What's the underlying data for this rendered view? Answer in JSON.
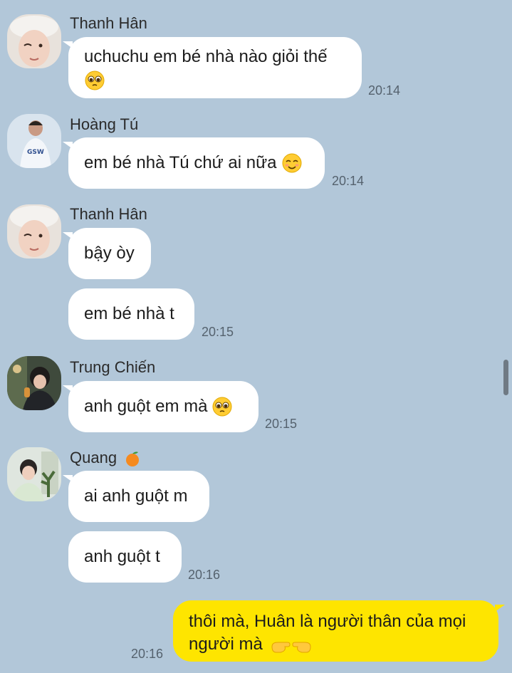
{
  "chat": {
    "colors": {
      "background": "#b2c7d9",
      "incoming_bubble": "#ffffff",
      "outgoing_bubble": "#fee500"
    },
    "messages": [
      {
        "sender": "Thanh Hân",
        "text": "uchuchu em bé nhà nào giỏi thế",
        "emoji": "pleading-face-emoji",
        "time": "20:14"
      },
      {
        "sender": "Hoàng Tú",
        "text": "em bé nhà Tú chứ ai nữa",
        "emoji": "smiling-face-emoji",
        "time": "20:14"
      },
      {
        "sender": "Thanh Hân",
        "text": "bậy òy"
      },
      {
        "text": "em bé nhà t",
        "time": "20:15"
      },
      {
        "sender": "Trung Chiến",
        "text": "anh guột em mà",
        "emoji": "pleading-face-emoji",
        "time": "20:15"
      },
      {
        "sender": "Quang",
        "sender_emoji": "tangerine-emoji",
        "text": "ai anh guột m"
      },
      {
        "text": "anh guột t",
        "time": "20:16"
      },
      {
        "outgoing": true,
        "text_line1": "thôi mà, Huân là người thân của mọi",
        "text_line2": "người mà",
        "emoji": "pointing-hands-emoji",
        "time": "20:16"
      }
    ]
  }
}
